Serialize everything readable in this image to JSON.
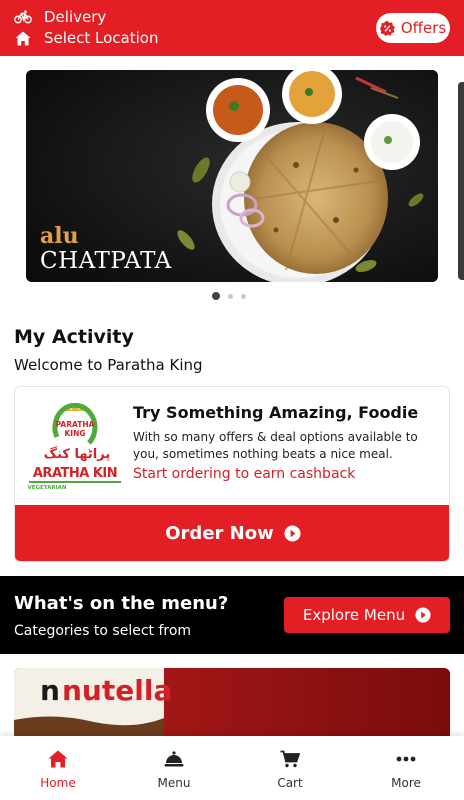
{
  "header": {
    "delivery_label": "Delivery",
    "location_label": "Select Location",
    "offers_label": "Offers"
  },
  "banner": {
    "title_line1": "alu",
    "title_line2": "CHATPATA",
    "slide_count": 3,
    "active_slide": 1
  },
  "activity": {
    "title": "My Activity",
    "subtitle": "Welcome to Paratha King",
    "card": {
      "logo_text": "PARATHA KING",
      "logo_urdu": "پراٹھا کنگ",
      "logo_sub": "VEGETARIAN",
      "title": "Try Something Amazing, Foodie",
      "description": "With so many offers & deal options available to you, sometimes nothing beats a nice meal.",
      "cashback_link": "Start ordering to earn cashback",
      "order_button": "Order Now"
    }
  },
  "menu_section": {
    "title": "What's on the menu?",
    "subtitle": "Categories to select from",
    "explore_button": "Explore Menu"
  },
  "product_image": {
    "brand_text": "nutella"
  },
  "bottom_nav": {
    "items": [
      {
        "label": "Home",
        "icon": "home-icon",
        "active": true
      },
      {
        "label": "Menu",
        "icon": "cloche-icon",
        "active": false
      },
      {
        "label": "Cart",
        "icon": "cart-icon",
        "active": false
      },
      {
        "label": "More",
        "icon": "more-icon",
        "active": false
      }
    ]
  },
  "colors": {
    "brand_red": "#e31e24",
    "banner_accent": "#e2a043",
    "menu_strip_bg": "#000000"
  }
}
